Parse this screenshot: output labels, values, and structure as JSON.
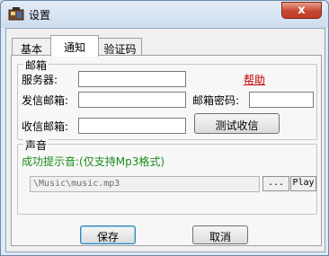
{
  "window": {
    "title": "设置",
    "close_symbol": "x"
  },
  "tabs": [
    {
      "label": "基本",
      "selected": false
    },
    {
      "label": "通知",
      "selected": true
    },
    {
      "label": "验证码",
      "selected": false
    }
  ],
  "mail_group": {
    "legend": "邮箱",
    "server_label": "服务器:",
    "server_value": "",
    "help_link": "帮助",
    "sender_label": "发信邮箱:",
    "sender_value": "",
    "password_label": "邮箱密码:",
    "password_value": "",
    "receiver_label": "收信邮箱:",
    "receiver_value": "",
    "test_button": "测试收信"
  },
  "sound_group": {
    "legend": "声音",
    "hint": "成功提示音:(仅支持Mp3格式)",
    "path_value": "\\Music\\music.mp3",
    "browse_button": "...",
    "play_button": "Play"
  },
  "footer": {
    "save_button": "保存",
    "cancel_button": "取消"
  },
  "colors": {
    "link": "#c00000",
    "hint": "#1d8c1d",
    "close_button": "#c74731"
  }
}
